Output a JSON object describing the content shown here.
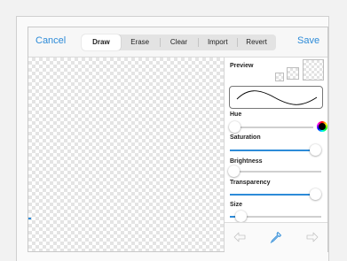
{
  "toolbar": {
    "cancel_label": "Cancel",
    "save_label": "Save",
    "tabs": [
      {
        "label": "Draw",
        "active": true
      },
      {
        "label": "Erase",
        "active": false
      },
      {
        "label": "Clear",
        "active": false
      },
      {
        "label": "Import",
        "active": false
      },
      {
        "label": "Revert",
        "active": false
      }
    ]
  },
  "sidebar": {
    "preview_label": "Preview",
    "hue": {
      "label": "Hue",
      "value": 0.0
    },
    "saturation": {
      "label": "Saturation",
      "value": 1.0
    },
    "brightness": {
      "label": "Brightness",
      "value": 0.0
    },
    "transparency": {
      "label": "Transparency",
      "value": 1.0
    },
    "size": {
      "label": "Size",
      "value": 0.12
    }
  },
  "bottom_icons": [
    "undo-arrow-icon",
    "eyedropper-icon",
    "redo-arrow-icon"
  ],
  "colors": {
    "accent": "#2d8bd8",
    "brush": "#000000"
  }
}
